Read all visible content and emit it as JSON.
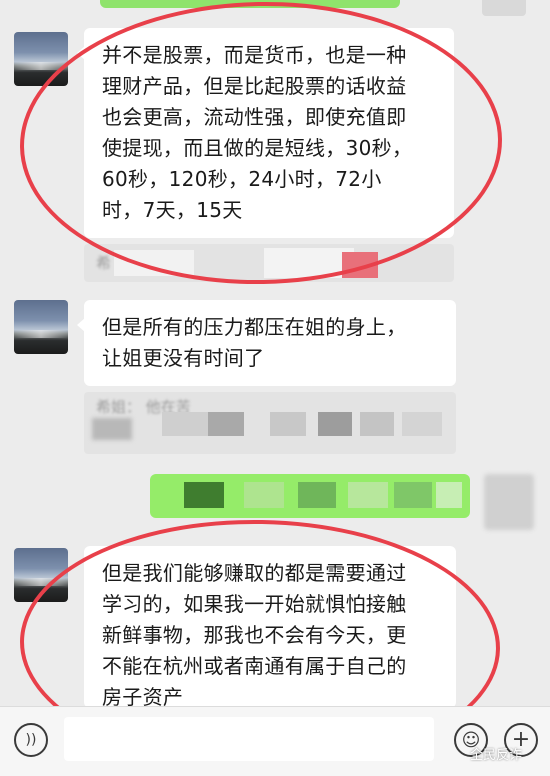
{
  "colors": {
    "accent_ring": "#e8404a",
    "own_bubble": "#95ec69",
    "chat_background": "#ececec",
    "bubble_background": "#ffffff"
  },
  "messages": [
    {
      "lines": [
        "并不是股票，而是货币，也是一种",
        "理财产品，但是比起股票的话收益",
        "也会更高，流动性强，即使充值即",
        "使提现，而且做的是短线，30秒，",
        "60秒，120秒，24小时，72小",
        "时，7天，15天"
      ],
      "quote_preview": "希"
    },
    {
      "lines": [
        "但是所有的压力都压在姐的身上，",
        "让姐更没有时间了"
      ],
      "quote_preview": "希姐：  他在苦"
    },
    {
      "lines": [
        "但是我们能够赚取的都是需要通过",
        "学习的，如果我一开始就惧怕接触",
        "新鲜事物，那我也不会有今天，更",
        "不能在杭州或者南通有属于自己的",
        "房子资产"
      ]
    }
  ],
  "bottom_bar": {
    "voice_icon": "voice-wave-icon",
    "emoji_icon": "smiley-icon",
    "plus_icon": "plus-icon",
    "plus_symbol": "+",
    "emoji_symbol": "☺",
    "voice_symbol": "))"
  },
  "watermark": {
    "text": "全民反诈"
  }
}
